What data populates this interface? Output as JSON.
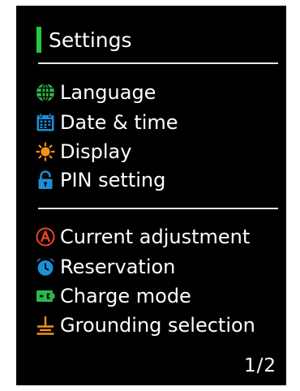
{
  "header": {
    "title": "Settings"
  },
  "colors": {
    "accent": "#27c93f",
    "screen_background": "#000000",
    "text": "#ffffff",
    "icon_green": "#2db84d",
    "icon_blue": "#1d8fd6",
    "icon_orange": "#f5901e",
    "icon_red": "#e8452c"
  },
  "menu_group_1": [
    {
      "label": "Language",
      "icon": "globe-icon"
    },
    {
      "label": "Date & time",
      "icon": "calendar-icon"
    },
    {
      "label": "Display",
      "icon": "sun-icon"
    },
    {
      "label": "PIN setting",
      "icon": "lock-icon"
    }
  ],
  "menu_group_2": [
    {
      "label": "Current adjustment",
      "icon": "ampere-icon"
    },
    {
      "label": "Reservation",
      "icon": "alarm-clock-icon"
    },
    {
      "label": "Charge mode",
      "icon": "battery-icon"
    },
    {
      "label": "Grounding selection",
      "icon": "ground-icon"
    }
  ],
  "footer": {
    "page_indicator": "1/2"
  }
}
